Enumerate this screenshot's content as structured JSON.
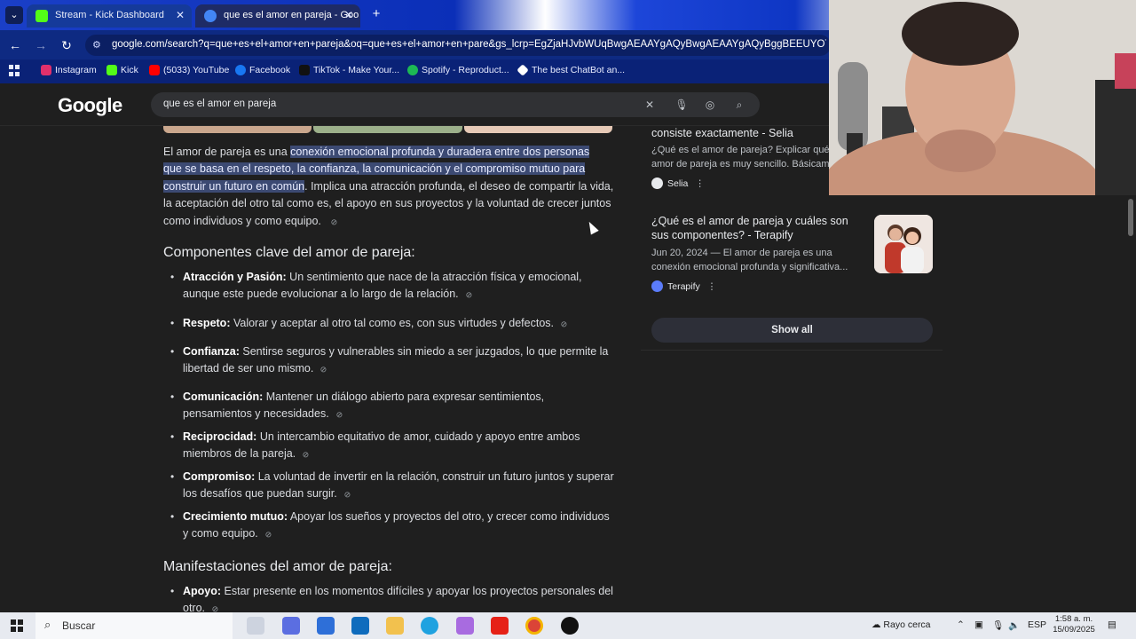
{
  "browser": {
    "tabs": [
      {
        "title": "Stream - Kick Dashboard",
        "active": false,
        "favicon_color": "#53fc18"
      },
      {
        "title": "que es el amor en pareja - Goo",
        "active": true,
        "favicon_color": "#4285f4"
      }
    ],
    "url": "google.com/search?q=que+es+el+amor+en+pareja&oq=que+es+el+amor+en+pare&gs_lcrp=EgZjaHJvbWUqBwgAEAAYgAQyBwgAEAAYgAQyBggBEEUYOTIICAIQ",
    "bookmarks": [
      {
        "label": "Instagram",
        "color": "#e1306c"
      },
      {
        "label": "Kick",
        "color": "#53fc18"
      },
      {
        "label": "(5033) YouTube",
        "color": "#ff0000"
      },
      {
        "label": "Facebook",
        "color": "#1877f2"
      },
      {
        "label": "TikTok - Make Your...",
        "color": "#111111"
      },
      {
        "label": "Spotify - Reproduct...",
        "color": "#1db954"
      },
      {
        "label": "The best ChatBot an...",
        "color": "#ffffff"
      }
    ]
  },
  "google": {
    "logo": "Google",
    "query": "que es el amor en pareja"
  },
  "main": {
    "intro_pre": "El amor de pareja es una ",
    "intro_hl1": "conexión emocional profunda y duradera entre dos personas",
    "intro_hl2": "que se basa en el respeto, la confianza, la comunicación y el compromiso mutuo para",
    "intro_hl3": "construir un futuro en común",
    "intro_post": ". Implica una atracción profunda, el deseo de compartir la vida, la aceptación del otro tal como es, el apoyo en sus proyectos y la voluntad de crecer juntos como individuos y como equipo.",
    "heading1": "Componentes clave del amor de pareja:",
    "components": [
      {
        "term": "Atracción y Pasión:",
        "text": " Un sentimiento que nace de la atracción física y emocional, aunque este puede evolucionar a lo largo de la relación."
      },
      {
        "term": "Respeto:",
        "text": " Valorar y aceptar al otro tal como es, con sus virtudes y defectos."
      },
      {
        "term": "Confianza:",
        "text": " Sentirse seguros y vulnerables sin miedo a ser juzgados, lo que permite la libertad de ser uno mismo."
      },
      {
        "term": "Comunicación:",
        "text": " Mantener un diálogo abierto para expresar sentimientos, pensamientos y necesidades."
      },
      {
        "term": "Reciprocidad:",
        "text": " Un intercambio equitativo de amor, cuidado y apoyo entre ambos miembros de la pareja."
      },
      {
        "term": "Compromiso:",
        "text": " La voluntad de invertir en la relación, construir un futuro juntos y superar los desafíos que puedan surgir."
      },
      {
        "term": "Crecimiento mutuo:",
        "text": " Apoyar los sueños y proyectos del otro, y crecer como individuos y como equipo."
      }
    ],
    "heading2": "Manifestaciones del amor de pareja:",
    "manifest_term": "Apoyo:",
    "manifest_text": " Estar presente en los momentos difíciles y apoyar los proyectos personales del otro."
  },
  "sources": {
    "card1_title": "consiste exactamente - Selia",
    "card1_snippet": "¿Qué es el amor de pareja? Explicar qué es el amor de pareja es muy sencillo. Básicamente...",
    "card1_source": "Selia",
    "card2_title": "¿Qué es el amor de pareja y cuáles son sus componentes? - Terapify",
    "card2_snippet": "Jun 20, 2024 — El amor de pareja es una conexión emocional profunda y significativa...",
    "card2_source": "Terapify",
    "show_all": "Show all"
  },
  "taskbar": {
    "search_label": "Buscar",
    "weather": "Rayo cerca",
    "lang": "ESP",
    "time": "1:58 a. m.",
    "date": "15/09/2025"
  }
}
